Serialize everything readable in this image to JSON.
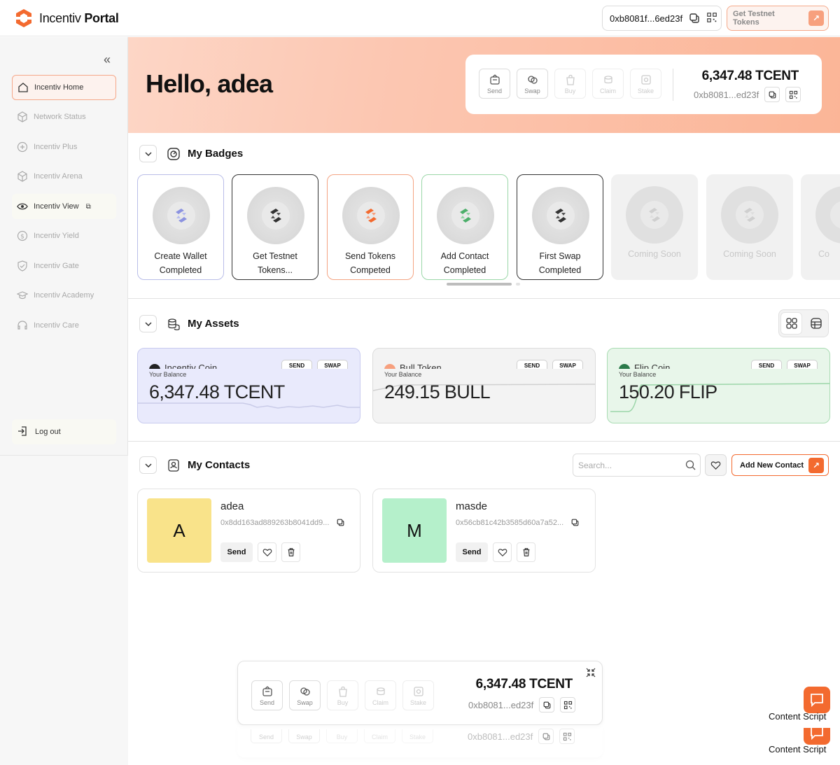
{
  "app": {
    "brand_light": "Incentiv",
    "brand_bold": "Portal",
    "brand_color": "#F36A2F"
  },
  "header": {
    "address": "0xb8081f...6ed23f",
    "testnet_label": "Get Testnet Tokens"
  },
  "sidebar": {
    "items": [
      {
        "label": "Incentiv Home",
        "icon": "home-icon"
      },
      {
        "label": "Network Status",
        "icon": "cube-icon"
      },
      {
        "label": "Incentiv Plus",
        "icon": "plus-circle-icon"
      },
      {
        "label": "Incentiv Arena",
        "icon": "cube-icon"
      },
      {
        "label": "Incentiv View",
        "icon": "eye-icon"
      },
      {
        "label": "Incentiv Yield",
        "icon": "dollar-icon"
      },
      {
        "label": "Incentiv Gate",
        "icon": "shield-icon"
      },
      {
        "label": "Incentiv Academy",
        "icon": "graduation-cap-icon"
      },
      {
        "label": "Incentiv Care",
        "icon": "headset-icon"
      }
    ],
    "logout_label": "Log out"
  },
  "hero": {
    "greeting": "Hello, adea",
    "actions": [
      "Send",
      "Swap",
      "Buy",
      "Claim",
      "Stake"
    ],
    "balance": "6,347.48 TCENT",
    "address": "0xb8081...ed23f"
  },
  "badges": {
    "title": "My Badges",
    "items": [
      {
        "line1": "Create Wallet",
        "line2": "Completed"
      },
      {
        "line1": "Get Testnet",
        "line2": "Tokens..."
      },
      {
        "line1": "Send Tokens",
        "line2": "Competed"
      },
      {
        "line1": "Add Contact",
        "line2": "Completed"
      },
      {
        "line1": "First Swap",
        "line2": "Completed"
      },
      {
        "line1": "Coming Soon",
        "line2": ""
      },
      {
        "line1": "Coming Soon",
        "line2": ""
      },
      {
        "line1": "Co",
        "line2": ""
      }
    ],
    "colors": {
      "wallet": "#8C93E0",
      "testnet": "#333333",
      "send": "#F36A2F",
      "contact": "#4CAF6A",
      "swap": "#333333"
    }
  },
  "assets": {
    "title": "My Assets",
    "balance_label": "Your Balance",
    "send_label": "SEND",
    "swap_label": "SWAP",
    "items": [
      {
        "name": "Incentiv Coin",
        "amount": "6,347.48 TCENT"
      },
      {
        "name": "Bull Token",
        "amount": "249.15 BULL"
      },
      {
        "name": "Flip Coin",
        "amount": "150.20 FLIP"
      }
    ]
  },
  "contacts": {
    "title": "My Contacts",
    "search_placeholder": "Search...",
    "add_label": "Add New Contact",
    "send_label": "Send",
    "items": [
      {
        "initial": "A",
        "name": "adea",
        "address": "0x8dd163ad889263b8041dd9...",
        "color": "#F9E38A"
      },
      {
        "initial": "M",
        "name": "masde",
        "address": "0x56cb81c42b3585d60a7a52...",
        "color": "#B5F0CB"
      }
    ]
  },
  "floating": {
    "actions": [
      "Send",
      "Swap",
      "Buy",
      "Claim",
      "Stake"
    ],
    "balance": "6,347.48 TCENT",
    "address": "0xb8081...ed23f"
  },
  "content_script": {
    "label": "Content Script"
  }
}
